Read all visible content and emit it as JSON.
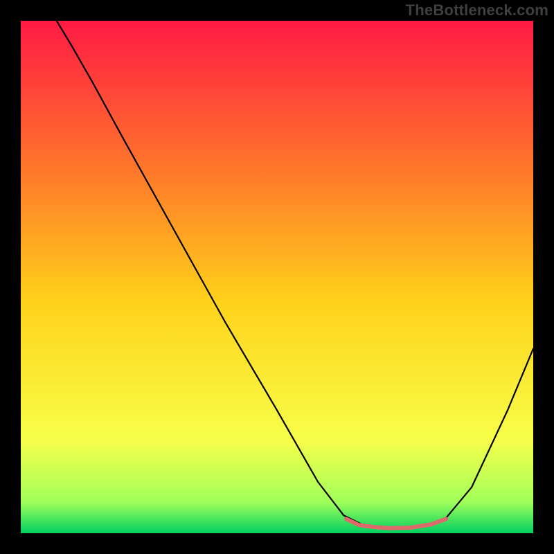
{
  "watermark": "TheBottleneck.com",
  "chart_data": {
    "type": "line",
    "title": "",
    "xlabel": "",
    "ylabel": "",
    "xlim": [
      0,
      100
    ],
    "ylim": [
      0,
      100
    ],
    "gradient": {
      "top_color": "#ff1a44",
      "mid_upper": "#ff7a2a",
      "mid": "#ffd21a",
      "mid_lower": "#f7ff4a",
      "green_band_top": "#9fff5a",
      "bottom_color": "#00d060"
    },
    "series": [
      {
        "name": "bottleneck-curve",
        "color": "#000000",
        "stroke_width": 2.2,
        "points": [
          {
            "x": 7.0,
            "y": 100.0
          },
          {
            "x": 10.0,
            "y": 95.0
          },
          {
            "x": 14.0,
            "y": 88.0
          },
          {
            "x": 20.0,
            "y": 77.0
          },
          {
            "x": 30.0,
            "y": 59.0
          },
          {
            "x": 40.0,
            "y": 41.0
          },
          {
            "x": 50.0,
            "y": 24.0
          },
          {
            "x": 58.0,
            "y": 10.0
          },
          {
            "x": 63.0,
            "y": 3.5
          },
          {
            "x": 67.0,
            "y": 1.5
          },
          {
            "x": 72.0,
            "y": 1.0
          },
          {
            "x": 78.0,
            "y": 1.2
          },
          {
            "x": 83.0,
            "y": 3.0
          },
          {
            "x": 88.0,
            "y": 9.0
          },
          {
            "x": 95.0,
            "y": 24.0
          },
          {
            "x": 100.0,
            "y": 36.0
          }
        ]
      },
      {
        "name": "optimal-band-marker",
        "color": "#dd6a6a",
        "stroke_width": 6,
        "points": [
          {
            "x": 63.5,
            "y": 2.8
          },
          {
            "x": 66.0,
            "y": 1.6
          },
          {
            "x": 69.0,
            "y": 1.2
          },
          {
            "x": 72.0,
            "y": 1.0
          },
          {
            "x": 76.0,
            "y": 1.1
          },
          {
            "x": 80.0,
            "y": 1.7
          },
          {
            "x": 83.0,
            "y": 2.8
          }
        ]
      }
    ]
  }
}
